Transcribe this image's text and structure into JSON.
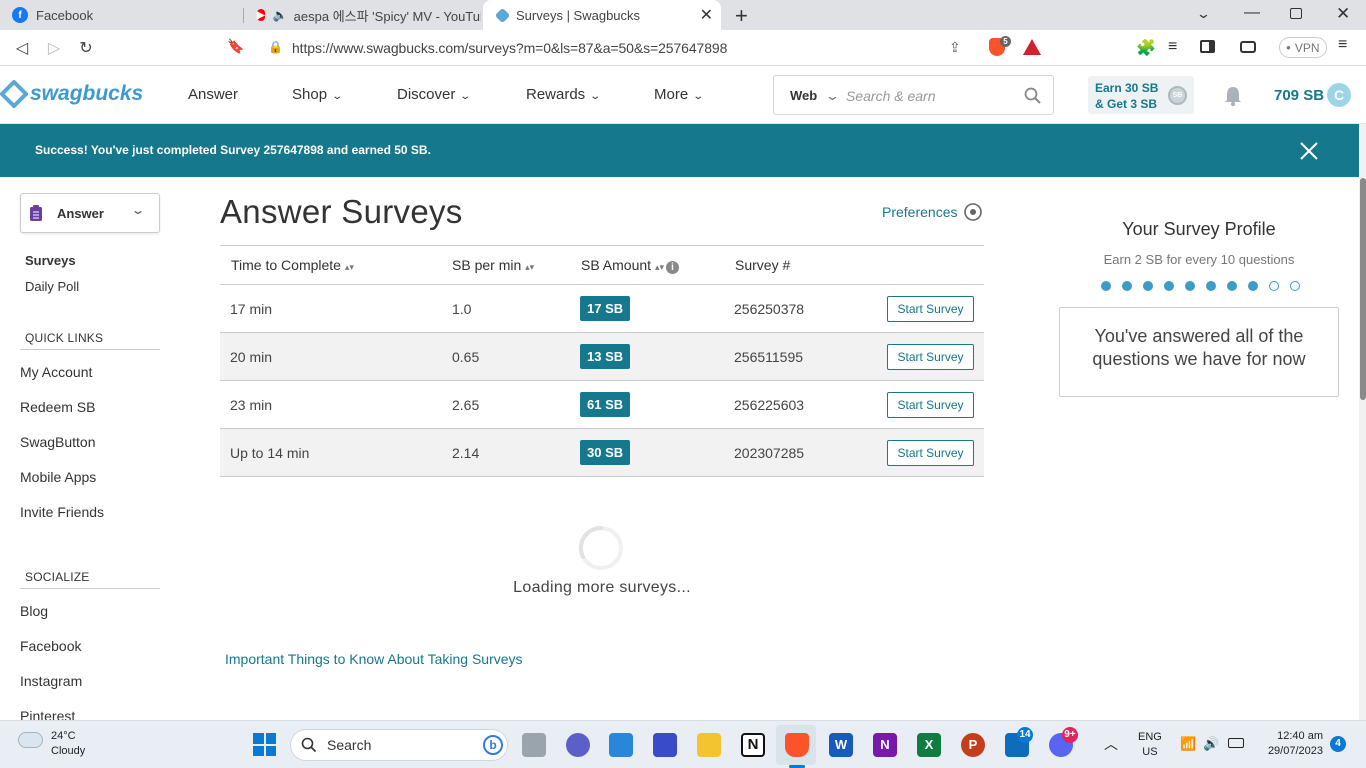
{
  "browser": {
    "tabs": [
      {
        "title": "Facebook"
      },
      {
        "title": "aespa 에스파 'Spicy' MV - YouTube"
      },
      {
        "title": "Surveys | Swagbucks"
      }
    ],
    "url": "https://www.swagbucks.com/surveys?m=0&ls=87&a=50&s=257647898",
    "shield_count": "5",
    "vpn_label": "VPN"
  },
  "header": {
    "logo": "swagbucks",
    "nav": [
      "Answer",
      "Shop",
      "Discover",
      "Rewards",
      "More"
    ],
    "search_scope": "Web",
    "search_placeholder": "Search & earn",
    "earn_line1": "Earn 30 SB",
    "earn_line2": "& Get 3 SB",
    "earn_badge": "SB",
    "balance": "709 SB",
    "avatar_letter": "C"
  },
  "banner": {
    "message": "Success! You've just completed Survey 257647898 and earned 50 SB."
  },
  "sidebar": {
    "dropdown_label": "Answer",
    "items": [
      "Surveys",
      "Daily Poll"
    ],
    "quick_links_heading": "QUICK LINKS",
    "quick_links": [
      "My Account",
      "Redeem SB",
      "SwagButton",
      "Mobile Apps",
      "Invite Friends"
    ],
    "socialize_heading": "SOCIALIZE",
    "social_links": [
      "Blog",
      "Facebook",
      "Instagram",
      "Pinterest"
    ]
  },
  "main": {
    "title": "Answer Surveys",
    "preferences": "Preferences",
    "columns": [
      "Time to Complete",
      "SB per min",
      "SB Amount",
      "Survey #"
    ],
    "rows": [
      {
        "time": "17 min",
        "per_min": "1.0",
        "amount": "17 SB",
        "survey": "256250378",
        "action": "Start Survey"
      },
      {
        "time": "20 min",
        "per_min": "0.65",
        "amount": "13 SB",
        "survey": "256511595",
        "action": "Start Survey"
      },
      {
        "time": "23 min",
        "per_min": "2.65",
        "amount": "61 SB",
        "survey": "256225603",
        "action": "Start Survey"
      },
      {
        "time": "Up to 14 min",
        "per_min": "2.14",
        "amount": "30 SB",
        "survey": "202307285",
        "action": "Start Survey"
      }
    ],
    "loading": "Loading more surveys...",
    "important_link": "Important Things to Know About Taking Surveys"
  },
  "profile": {
    "title": "Your Survey Profile",
    "subtitle": "Earn 2 SB for every 10 questions",
    "progress_filled": 8,
    "progress_total": 10,
    "message_line1": "You've answered all of the",
    "message_line2": "questions we have for now"
  },
  "taskbar": {
    "temp": "24°C",
    "weather": "Cloudy",
    "search": "Search",
    "lang1": "ENG",
    "lang2": "US",
    "time": "12:40 am",
    "date": "29/07/2023",
    "notifications": "4",
    "outlook_badge": "14",
    "discord_badge": "9+"
  },
  "colors": {
    "brand": "#16788c",
    "tab_bg": "#dfe1e5"
  }
}
